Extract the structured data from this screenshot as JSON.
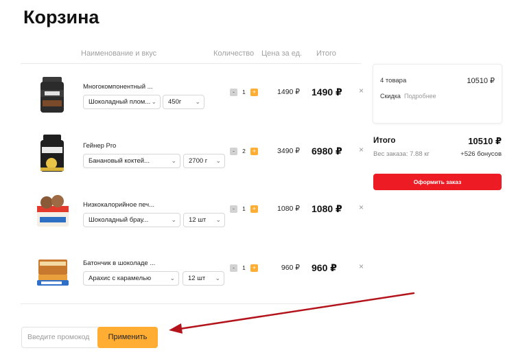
{
  "page": {
    "title": "Корзина"
  },
  "table_header": {
    "name_flavor": "Наименование и вкус",
    "quantity": "Количество",
    "unit_price": "Цена за ед.",
    "total": "Итого"
  },
  "items": [
    {
      "name": "Многокомпонентный ...",
      "flavor": "Шоколадный плом...",
      "size": "450г",
      "qty": "1",
      "unit_price": "1490 ₽",
      "total": "1490 ₽",
      "minus": "-",
      "plus": "+",
      "remove": "×"
    },
    {
      "name": "Гейнер Pro",
      "flavor": "Банановый коктей...",
      "size": "2700 г",
      "qty": "2",
      "unit_price": "3490 ₽",
      "total": "6980 ₽",
      "minus": "-",
      "plus": "+",
      "remove": "×"
    },
    {
      "name": "Низкокалорийное печ...",
      "flavor": "Шоколадный брау...",
      "size": "12 шт",
      "qty": "1",
      "unit_price": "1080 ₽",
      "total": "1080 ₽",
      "minus": "-",
      "plus": "+",
      "remove": "×"
    },
    {
      "name": "Батончик в шоколаде ...",
      "flavor": "Арахис с карамелью",
      "size": "12 шт",
      "qty": "1",
      "unit_price": "960 ₽",
      "total": "960 ₽",
      "minus": "-",
      "plus": "+",
      "remove": "×"
    }
  ],
  "summary": {
    "items_count": "4 товара",
    "items_sum": "10510 ₽",
    "discount_label": "Скидка",
    "discount_link": "Подробнее",
    "total_label": "Итого",
    "total_value": "10510 ₽",
    "weight": "Вес заказа: 7.88 кг",
    "bonus": "+526 бонусов",
    "order_button": "Оформить заказ"
  },
  "promo": {
    "placeholder": "Введите промокод",
    "apply_button": "Применить"
  },
  "colors": {
    "accent_orange": "#ffae33",
    "order_red": "#ed1c24",
    "arrow_red": "#b3141b"
  }
}
